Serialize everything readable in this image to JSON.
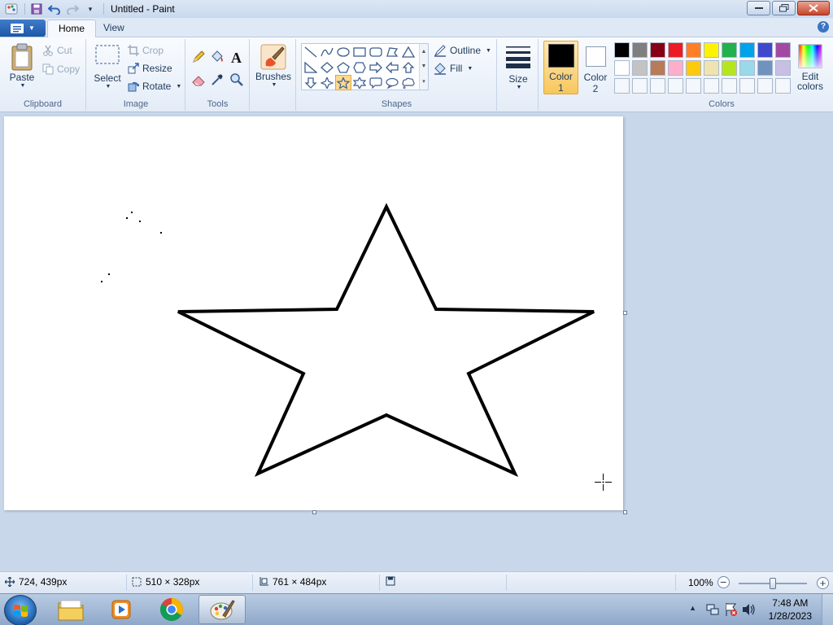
{
  "window": {
    "title": "Untitled - Paint"
  },
  "tabs": [
    {
      "label": "Home"
    },
    {
      "label": "View"
    }
  ],
  "clipboard": {
    "group_label": "Clipboard",
    "paste": "Paste",
    "cut": "Cut",
    "copy": "Copy"
  },
  "image": {
    "group_label": "Image",
    "select": "Select",
    "crop": "Crop",
    "resize": "Resize",
    "rotate": "Rotate"
  },
  "tools": {
    "group_label": "Tools"
  },
  "brushes": {
    "label": "Brushes"
  },
  "shapes": {
    "group_label": "Shapes",
    "outline": "Outline",
    "fill": "Fill",
    "items": [
      "line-icon",
      "curve-icon",
      "oval-icon",
      "rectangle-icon",
      "rounded-rectangle-icon",
      "polygon-icon",
      "triangle-icon",
      "right-triangle-icon",
      "diamond-icon",
      "pentagon-icon",
      "hexagon-icon",
      "right-arrow-icon",
      "left-arrow-icon",
      "up-arrow-icon",
      "down-arrow-icon",
      "four-point-star-icon",
      "five-point-star-icon",
      "six-point-star-icon",
      "rounded-callout-icon",
      "oval-callout-icon",
      "cloud-callout-icon"
    ],
    "selected": "five-point-star-icon"
  },
  "size": {
    "label": "Size"
  },
  "color1": {
    "label_line1": "Color",
    "label_line2": "1",
    "color": "#000000"
  },
  "color2": {
    "label_line1": "Color",
    "label_line2": "2",
    "color": "#ffffff"
  },
  "colors": {
    "group_label": "Colors",
    "edit_line1": "Edit",
    "edit_line2": "colors",
    "palette": [
      "#000000",
      "#7f7f7f",
      "#880015",
      "#ed1c24",
      "#ff7f27",
      "#fff200",
      "#22b14c",
      "#00a2e8",
      "#3f48cc",
      "#a349a4",
      "#ffffff",
      "#c3c3c3",
      "#b97a57",
      "#ffaec9",
      "#ffc90e",
      "#efe4b0",
      "#b5e61d",
      "#99d9ea",
      "#7092be",
      "#c8bfe7",
      "#f4f7fb",
      "#f4f7fb",
      "#f4f7fb",
      "#f4f7fb",
      "#f4f7fb",
      "#f4f7fb",
      "#f4f7fb",
      "#f4f7fb",
      "#f4f7fb",
      "#f4f7fb"
    ]
  },
  "status": {
    "cursor_pos": "724, 439px",
    "selection_size": "510 × 328px",
    "canvas_size": "761 × 484px",
    "zoom": "100%",
    "zoom_level": 0.5
  },
  "taskbar": {
    "apps": [
      "explorer-icon",
      "media-player-icon",
      "chrome-icon",
      "paint-icon"
    ],
    "active_app": "paint-icon",
    "time": "7:48 AM",
    "date": "1/28/2023"
  }
}
